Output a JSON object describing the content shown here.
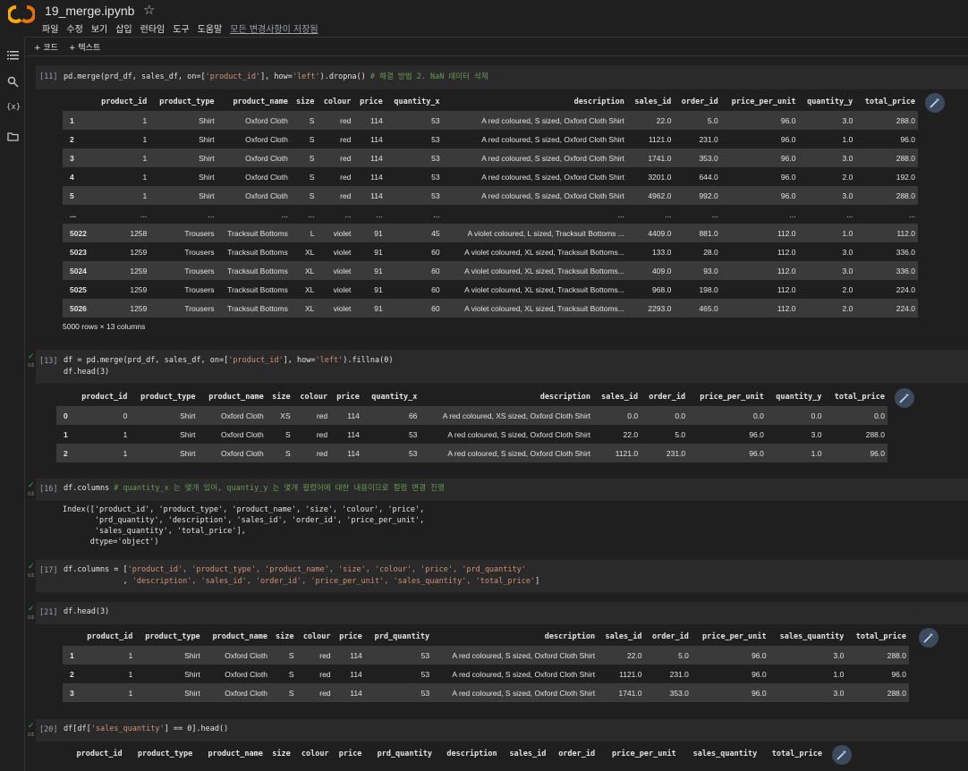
{
  "app": {
    "notebook_title": "19_merge.ipynb",
    "menu": [
      "파일",
      "수정",
      "보기",
      "삽입",
      "런타임",
      "도구",
      "도움말"
    ],
    "save_status": "모든 변경사항이 저장됨"
  },
  "toolbar": {
    "add_code": "+ 코드",
    "add_text": "+ 텍스트"
  },
  "colors": {
    "accent_check": "#34a853",
    "string": "#ce9178",
    "comment": "#6a9955",
    "row_alt": "#3a3a3a"
  },
  "icons": [
    "colab-logo",
    "star-icon",
    "toc-icon",
    "search-icon",
    "variables-icon",
    "folder-icon",
    "check-icon",
    "magic-wand-icon"
  ],
  "cells": {
    "c1": {
      "count": "[11]",
      "code_a": "pd.merge(prd_df, sales_df, on=[",
      "code_s1": "'product_id'",
      "code_b": "], how=",
      "code_s2": "'left'",
      "code_c": ").dropna() ",
      "comment": "# 해결 방법 2. NaN 데이터 삭제",
      "columns": [
        "",
        "product_id",
        "product_type",
        "product_name",
        "size",
        "colour",
        "price",
        "quantity_x",
        "description",
        "sales_id",
        "order_id",
        "price_per_unit",
        "quantity_y",
        "total_price"
      ],
      "rows": [
        [
          "1",
          "1",
          "Shirt",
          "Oxford Cloth",
          "S",
          "red",
          "114",
          "53",
          "A red coloured, S sized, Oxford Cloth Shirt",
          "22.0",
          "5.0",
          "96.0",
          "3.0",
          "288.0"
        ],
        [
          "2",
          "1",
          "Shirt",
          "Oxford Cloth",
          "S",
          "red",
          "114",
          "53",
          "A red coloured, S sized, Oxford Cloth Shirt",
          "1121.0",
          "231.0",
          "96.0",
          "1.0",
          "96.0"
        ],
        [
          "3",
          "1",
          "Shirt",
          "Oxford Cloth",
          "S",
          "red",
          "114",
          "53",
          "A red coloured, S sized, Oxford Cloth Shirt",
          "1741.0",
          "353.0",
          "96.0",
          "3.0",
          "288.0"
        ],
        [
          "4",
          "1",
          "Shirt",
          "Oxford Cloth",
          "S",
          "red",
          "114",
          "53",
          "A red coloured, S sized, Oxford Cloth Shirt",
          "3201.0",
          "644.0",
          "96.0",
          "2.0",
          "192.0"
        ],
        [
          "5",
          "1",
          "Shirt",
          "Oxford Cloth",
          "S",
          "red",
          "114",
          "53",
          "A red coloured, S sized, Oxford Cloth Shirt",
          "4962.0",
          "992.0",
          "96.0",
          "3.0",
          "288.0"
        ],
        [
          "...",
          "...",
          "...",
          "...",
          "...",
          "...",
          "...",
          "...",
          "...",
          "...",
          "...",
          "...",
          "...",
          "..."
        ],
        [
          "5022",
          "1258",
          "Trousers",
          "Tracksuit Bottoms",
          "L",
          "violet",
          "91",
          "45",
          "A violet coloured, L sized, Tracksuit Bottoms ...",
          "4409.0",
          "881.0",
          "112.0",
          "1.0",
          "112.0"
        ],
        [
          "5023",
          "1259",
          "Trousers",
          "Tracksuit Bottoms",
          "XL",
          "violet",
          "91",
          "60",
          "A violet coloured, XL sized, Tracksuit Bottoms...",
          "133.0",
          "28.0",
          "112.0",
          "3.0",
          "336.0"
        ],
        [
          "5024",
          "1259",
          "Trousers",
          "Tracksuit Bottoms",
          "XL",
          "violet",
          "91",
          "60",
          "A violet coloured, XL sized, Tracksuit Bottoms...",
          "409.0",
          "93.0",
          "112.0",
          "3.0",
          "336.0"
        ],
        [
          "5025",
          "1259",
          "Trousers",
          "Tracksuit Bottoms",
          "XL",
          "violet",
          "91",
          "60",
          "A violet coloured, XL sized, Tracksuit Bottoms...",
          "968.0",
          "198.0",
          "112.0",
          "2.0",
          "224.0"
        ],
        [
          "5026",
          "1259",
          "Trousers",
          "Tracksuit Bottoms",
          "XL",
          "violet",
          "91",
          "60",
          "A violet coloured, XL sized, Tracksuit Bottoms...",
          "2293.0",
          "465.0",
          "112.0",
          "2.0",
          "224.0"
        ]
      ],
      "shape": "5000 rows × 13 columns"
    },
    "c2": {
      "count": "[13]",
      "exec_time": "0초",
      "line1_a": "df = pd.merge(prd_df, sales_df, on=[",
      "line1_s1": "'product_id'",
      "line1_b": "], how=",
      "line1_s2": "'left'",
      "line1_c": ").fillna(0)",
      "line2": "df.head(3)",
      "columns": [
        "",
        "product_id",
        "product_type",
        "product_name",
        "size",
        "colour",
        "price",
        "quantity_x",
        "description",
        "sales_id",
        "order_id",
        "price_per_unit",
        "quantity_y",
        "total_price"
      ],
      "rows": [
        [
          "0",
          "0",
          "Shirt",
          "Oxford Cloth",
          "XS",
          "red",
          "114",
          "66",
          "A red coloured, XS sized, Oxford Cloth Shirt",
          "0.0",
          "0.0",
          "0.0",
          "0.0",
          "0.0"
        ],
        [
          "1",
          "1",
          "Shirt",
          "Oxford Cloth",
          "S",
          "red",
          "114",
          "53",
          "A red coloured, S sized, Oxford Cloth Shirt",
          "22.0",
          "5.0",
          "96.0",
          "3.0",
          "288.0"
        ],
        [
          "2",
          "1",
          "Shirt",
          "Oxford Cloth",
          "S",
          "red",
          "114",
          "53",
          "A red coloured, S sized, Oxford Cloth Shirt",
          "1121.0",
          "231.0",
          "96.0",
          "1.0",
          "96.0"
        ]
      ]
    },
    "c3": {
      "count": "[16]",
      "exec_time": "0초",
      "code": "df.columns ",
      "comment": "# quantity_x 는 몇개 있어, quantiy_y 는 몇개 팔렸어에 대한 내용이므로 컬럼 변경 진행",
      "output": "Index(['product_id', 'product_type', 'product_name', 'size', 'colour', 'price',\n       'prd_quantity', 'description', 'sales_id', 'order_id', 'price_per_unit',\n       'sales_quantity', 'total_price'],\n      dtype='object')"
    },
    "c4": {
      "count": "[17]",
      "exec_time": "0초",
      "head": "df.columns = [",
      "line1_s": "'product_id', 'product_type', 'product_name', 'size', 'colour', 'price', 'prd_quantity'",
      "line2_s": "'description', 'sales_id', 'order_id', 'price_per_unit', 'sales_quantity', 'total_price'",
      "comma": ",",
      "tail": "]"
    },
    "c5": {
      "count": "[21]",
      "exec_time": "0초",
      "code": "df.head(3)",
      "columns": [
        "",
        "product_id",
        "product_type",
        "product_name",
        "size",
        "colour",
        "price",
        "prd_quantity",
        "description",
        "sales_id",
        "order_id",
        "price_per_unit",
        "sales_quantity",
        "total_price"
      ],
      "rows": [
        [
          "1",
          "1",
          "Shirt",
          "Oxford Cloth",
          "S",
          "red",
          "114",
          "53",
          "A red coloured, S sized, Oxford Cloth Shirt",
          "22.0",
          "5.0",
          "96.0",
          "3.0",
          "288.0"
        ],
        [
          "2",
          "1",
          "Shirt",
          "Oxford Cloth",
          "S",
          "red",
          "114",
          "53",
          "A red coloured, S sized, Oxford Cloth Shirt",
          "1121.0",
          "231.0",
          "96.0",
          "1.0",
          "96.0"
        ],
        [
          "3",
          "1",
          "Shirt",
          "Oxford Cloth",
          "S",
          "red",
          "114",
          "53",
          "A red coloured, S sized, Oxford Cloth Shirt",
          "1741.0",
          "353.0",
          "96.0",
          "3.0",
          "288.0"
        ]
      ]
    },
    "c6": {
      "count": "[20]",
      "exec_time": "0초",
      "code_a": "df[df[",
      "code_s": "'sales_quantity'",
      "code_b": "] == 0].head()",
      "columns": [
        "",
        "product_id",
        "product_type",
        "product_name",
        "size",
        "colour",
        "price",
        "prd_quantity",
        "description",
        "sales_id",
        "order_id",
        "price_per_unit",
        "sales_quantity",
        "total_price"
      ]
    }
  }
}
